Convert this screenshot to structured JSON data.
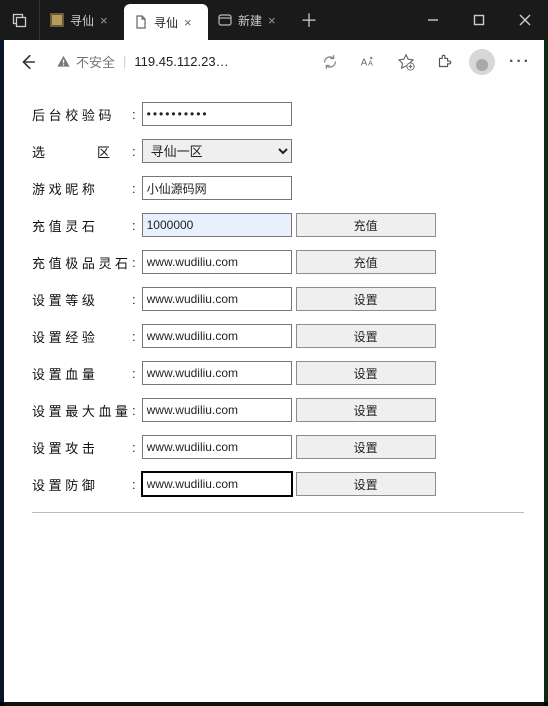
{
  "window": {
    "tabs": [
      {
        "title": "寻仙",
        "favicon": "image"
      },
      {
        "title": "寻仙",
        "favicon": "page"
      },
      {
        "title": "新建",
        "favicon": "edge"
      }
    ],
    "add_tab": "＋"
  },
  "toolbar": {
    "insecure_label": "不安全",
    "url": "119.45.112.23…",
    "separator": "|"
  },
  "form": {
    "rows": {
      "verify": {
        "label": "后 台 校 验 码",
        "value": "••••••••••"
      },
      "region": {
        "label": "选　　　　区",
        "selected": "寻仙一区"
      },
      "nickname": {
        "label": "游 戏 昵 称",
        "value": "小仙源码网"
      },
      "recharge_ls": {
        "label": "充 值 灵 石",
        "value": "1000000",
        "button": "充值"
      },
      "recharge_jp": {
        "label": "充 值 极 品 灵 石",
        "value": "www.wudiliu.com",
        "button": "充值"
      },
      "level": {
        "label": "设 置 等 级",
        "value": "www.wudiliu.com",
        "button": "设置"
      },
      "exp": {
        "label": "设 置 经 验",
        "value": "www.wudiliu.com",
        "button": "设置"
      },
      "hp": {
        "label": "设 置 血 量",
        "value": "www.wudiliu.com",
        "button": "设置"
      },
      "maxhp": {
        "label": "设 置 最 大 血 量",
        "value": "www.wudiliu.com",
        "button": "设置"
      },
      "atk": {
        "label": "设 置 攻 击",
        "value": "www.wudiliu.com",
        "button": "设置"
      },
      "def": {
        "label": "设 置 防 御",
        "value": "www.wudiliu.com",
        "button": "设置"
      }
    }
  }
}
